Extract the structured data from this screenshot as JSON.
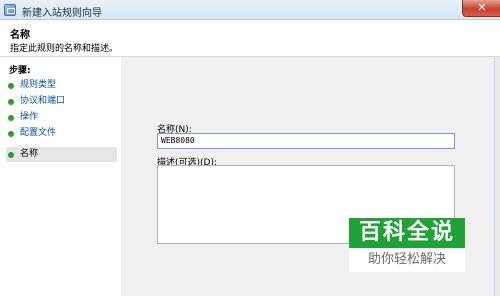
{
  "window": {
    "title": "新建入站规则向导",
    "close_glyph": "✕",
    "icon": "firewall-app-icon"
  },
  "header": {
    "title": "名称",
    "description": "指定此规则的名称和描述。"
  },
  "steps": {
    "label": "步骤:",
    "items": [
      {
        "label": "规则类型",
        "current": false
      },
      {
        "label": "协议和端口",
        "current": false
      },
      {
        "label": "操作",
        "current": false
      },
      {
        "label": "配置文件",
        "current": false
      },
      {
        "label": "名称",
        "current": true
      }
    ],
    "dot_color": "#2e9b2e"
  },
  "form": {
    "name_label": "名称(N):",
    "name_value": "WEB8080",
    "description_label": "描述(可选)(D):",
    "description_value": ""
  },
  "watermark": {
    "title": "百科全说",
    "subtitle": "助你轻松解决",
    "color": "#1fa338"
  },
  "colors": {
    "link": "#0b4fad",
    "content_bg": "#f0f0f0",
    "current_step_bg": "#e6e6e6"
  }
}
